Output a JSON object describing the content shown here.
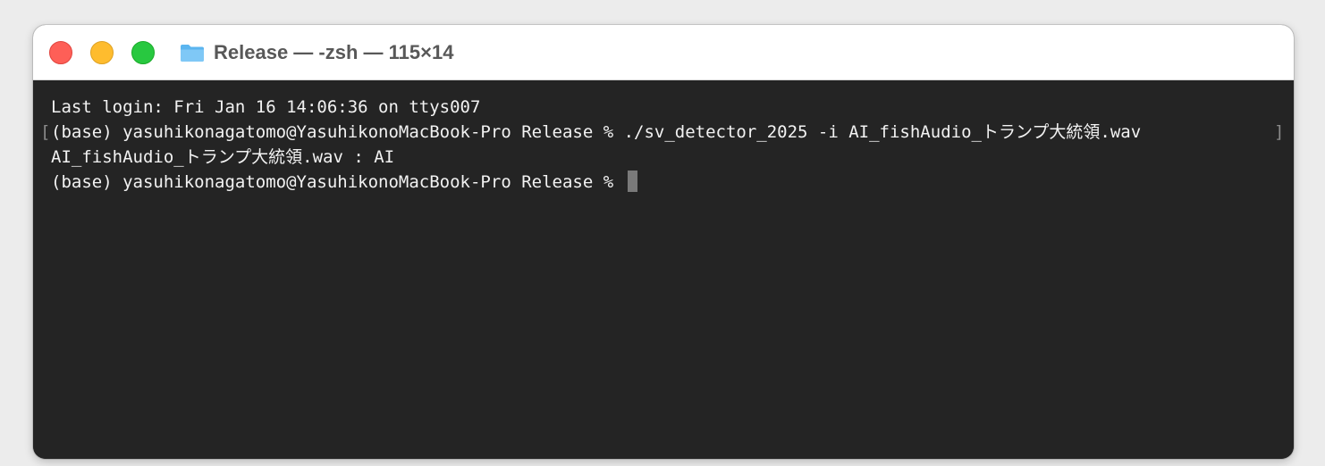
{
  "window": {
    "title": "Release — -zsh — 115×14",
    "folder_icon": "folder-icon"
  },
  "colors": {
    "close": "#fe5f57",
    "minimize": "#febc2e",
    "zoom": "#28c840",
    "terminal_bg": "#242424",
    "terminal_text": "#f2f2f2",
    "folder": "#5bb5ef"
  },
  "terminal": {
    "lines": [
      "Last login: Fri Jan 16 14:06:36 on ttys007",
      "(base) yasuhikonagatomo@YasuhikonoMacBook-Pro Release % ./sv_detector_2025 -i AI_fishAudio_トランプ大統領.wav",
      "AI_fishAudio_トランプ大統領.wav : AI",
      "(base) yasuhikonagatomo@YasuhikonoMacBook-Pro Release % "
    ],
    "selection_bracket_left": "[",
    "selection_bracket_right": "]"
  }
}
